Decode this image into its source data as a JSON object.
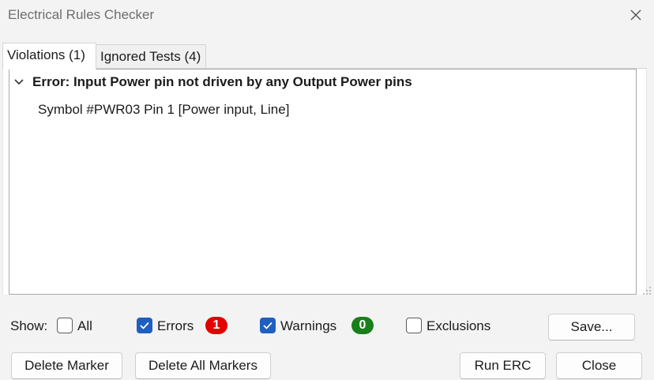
{
  "window": {
    "title": "Electrical Rules Checker"
  },
  "tabs": [
    {
      "label": "Violations (1)",
      "active": true
    },
    {
      "label": "Ignored Tests (4)",
      "active": false
    }
  ],
  "violations": [
    {
      "group": "Error: Input Power pin not driven by any Output Power pins",
      "expanded": true,
      "items": [
        "Symbol #PWR03 Pin 1 [Power input, Line]"
      ]
    }
  ],
  "filters": {
    "show_label": "Show:",
    "all": {
      "label": "All",
      "checked": false
    },
    "errors": {
      "label": "Errors",
      "checked": true,
      "count": "1",
      "badge_color": "#e40000"
    },
    "warnings": {
      "label": "Warnings",
      "checked": true,
      "count": "0",
      "badge_color": "#1a7f1a"
    },
    "exclusions": {
      "label": "Exclusions",
      "checked": false
    }
  },
  "buttons": {
    "save": "Save...",
    "delete_marker": "Delete Marker",
    "delete_all_markers": "Delete All Markers",
    "run_erc": "Run ERC",
    "close": "Close"
  },
  "colors": {
    "accent": "#1f5fbf"
  }
}
